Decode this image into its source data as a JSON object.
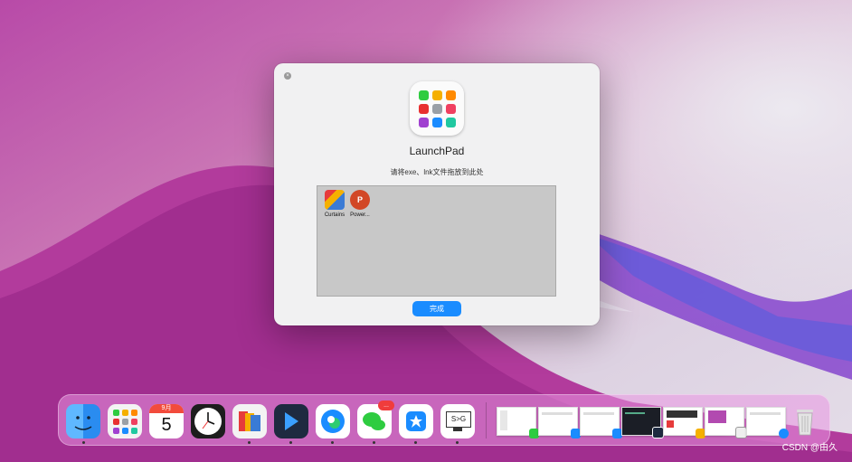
{
  "dialog": {
    "close_symbol": "×",
    "app_icon": "launchpad-grid-icon",
    "app_icon_colors": [
      "#2ecc40",
      "#f5b000",
      "#ff8a00",
      "#e83030",
      "#9aa0a6",
      "#f04060",
      "#a040d0",
      "#1a8cff",
      "#20c8a0"
    ],
    "title": "LaunchPad",
    "hint": "请将exe、lnk文件拖放到此处",
    "dropped_items": [
      {
        "label": "Curtains",
        "icon": "curtains-icon",
        "color": "#3a7bd5"
      },
      {
        "label": "Power...",
        "icon": "powerpoint-icon",
        "color": "#d24726"
      }
    ],
    "done_label": "完成"
  },
  "dock": {
    "calendar": {
      "month": "9月",
      "day": "5"
    },
    "apps": [
      {
        "name": "finder-icon",
        "color": "#2a8cf0"
      },
      {
        "name": "launchpad-icon",
        "color": "#f3f3f3"
      },
      {
        "name": "calendar-icon",
        "color": "#ffffff"
      },
      {
        "name": "clock-icon",
        "color": "#1d1d1d"
      },
      {
        "name": "curtains-icon",
        "color": "#f3f3f3"
      },
      {
        "name": "vscode-icon",
        "color": "#1e2a40"
      },
      {
        "name": "edge-icon",
        "color": "#ffffff"
      },
      {
        "name": "wechat-icon",
        "color": "#ffffff",
        "badge": "..."
      },
      {
        "name": "ticktick-icon",
        "color": "#ffffff"
      },
      {
        "name": "terminal-icon",
        "color": "#ffffff",
        "text": "S>G"
      }
    ],
    "windows": [
      {
        "name": "window-thumb-1",
        "mini": "#2ecc40"
      },
      {
        "name": "window-thumb-2",
        "mini": "#1a8cff"
      },
      {
        "name": "window-thumb-3",
        "mini": "#1a8cff"
      },
      {
        "name": "window-thumb-4",
        "mini": "#1e2a40"
      },
      {
        "name": "window-thumb-5",
        "mini": "#f5b000"
      },
      {
        "name": "window-thumb-6",
        "mini": "#eeeeee"
      },
      {
        "name": "window-thumb-7",
        "mini": "#1a8cff"
      }
    ],
    "trash_icon": "trash-icon"
  },
  "watermark": "CSDN @由久"
}
